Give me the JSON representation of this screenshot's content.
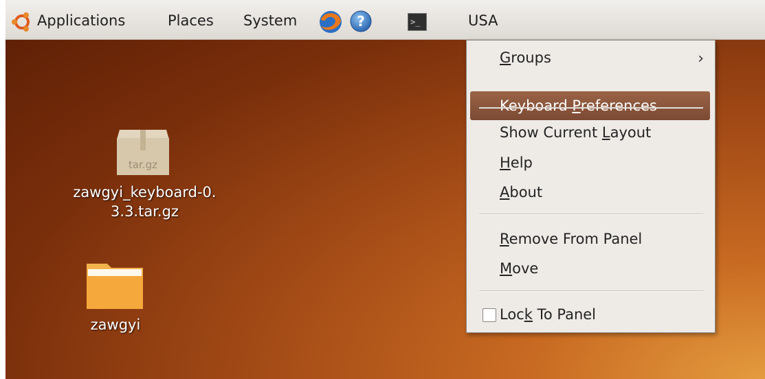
{
  "panel": {
    "applications": "Applications",
    "places": "Places",
    "system": "System",
    "keyboard_indicator": "USA",
    "icons": [
      "ubuntu-logo-icon",
      "firefox-icon",
      "help-icon",
      "terminal-icon"
    ]
  },
  "desktop": {
    "archive": {
      "badge": "tar.gz",
      "label_line1": "zawgyi_keyboard-0.",
      "label_line2": "3.3.tar.gz"
    },
    "folder": {
      "label": "zawgyi"
    }
  },
  "menu": {
    "groups": {
      "pre": "",
      "u": "G",
      "post": "roups"
    },
    "keyboard_preferences": {
      "pre": "Keyboard ",
      "u": "P",
      "post": "references"
    },
    "show_current_layout": {
      "pre": "Show Current ",
      "u": "L",
      "post": "ayout"
    },
    "help": {
      "pre": "",
      "u": "H",
      "post": "elp"
    },
    "about": {
      "pre": "",
      "u": "A",
      "post": "bout"
    },
    "remove_from_panel": {
      "pre": "",
      "u": "R",
      "post": "emove From Panel"
    },
    "move": {
      "pre": "",
      "u": "M",
      "post": "ove"
    },
    "lock_to_panel": {
      "pre": "Loc",
      "u": "k",
      "post": " To Panel",
      "checked": false
    }
  },
  "colors": {
    "highlight": "#8a5639",
    "wallpaper": "#a24a16"
  }
}
